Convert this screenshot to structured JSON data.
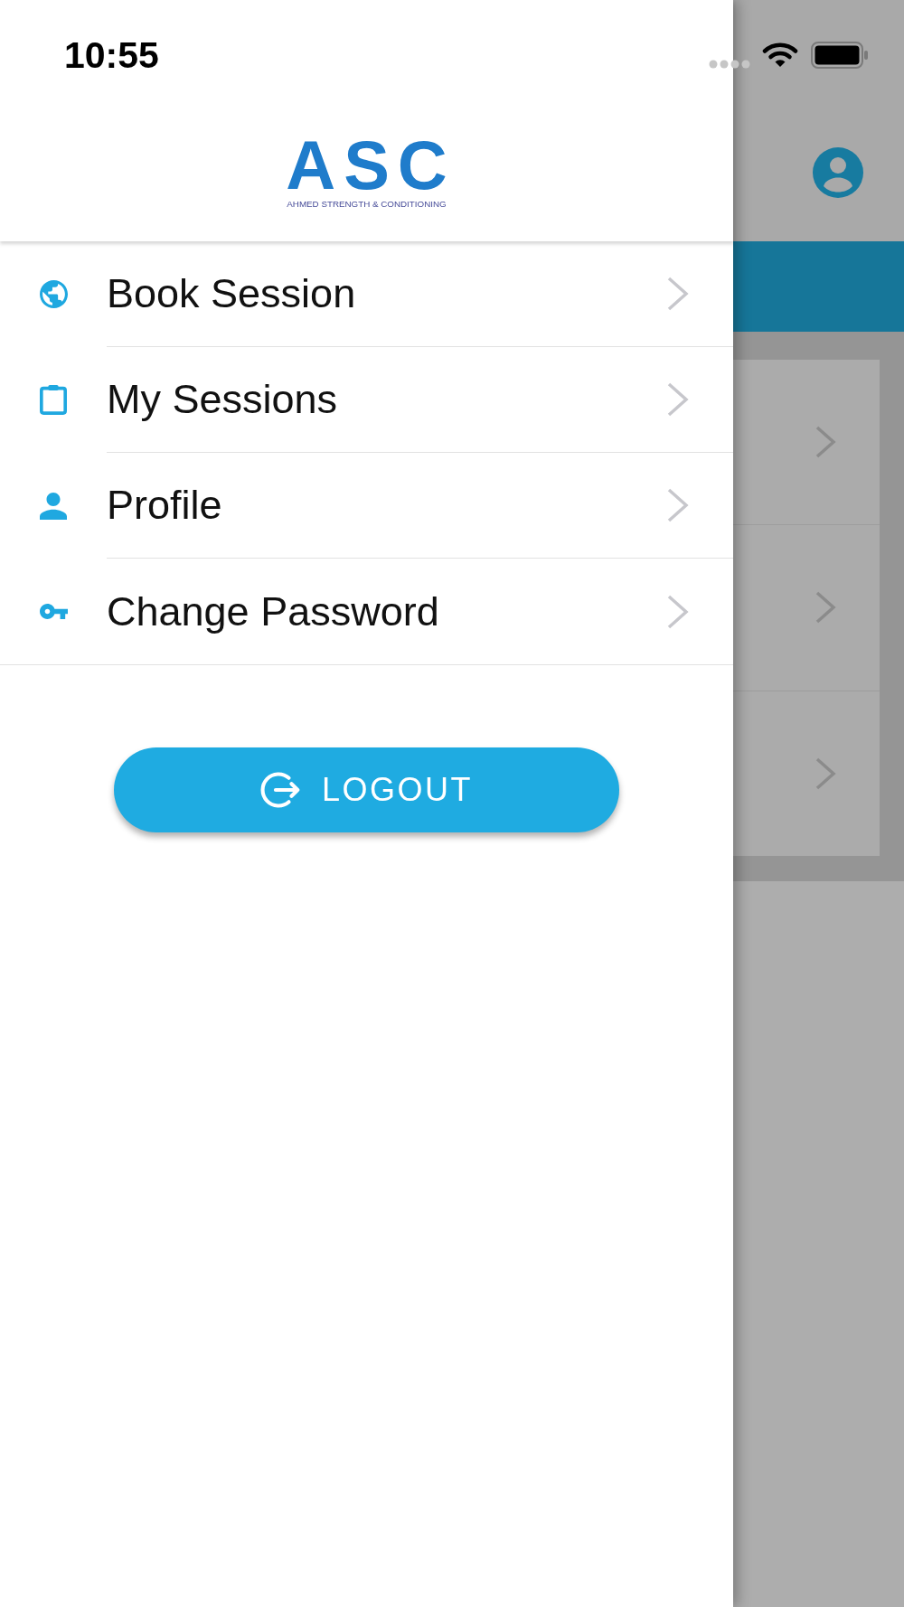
{
  "status_bar": {
    "time": "10:55"
  },
  "drawer": {
    "logo": {
      "wordmark": "ASC",
      "tagline": "AHMED STRENGTH & CONDITIONING"
    },
    "menu_items": [
      {
        "label": "Book Session"
      },
      {
        "label": "My Sessions"
      },
      {
        "label": "Profile"
      },
      {
        "label": "Change Password"
      }
    ],
    "logout_button": {
      "label": "LOGOUT"
    }
  },
  "background_page": {
    "list_rows": [
      {
        "chevron": true
      },
      {
        "chevron": true
      },
      {
        "chevron": true
      }
    ]
  }
}
